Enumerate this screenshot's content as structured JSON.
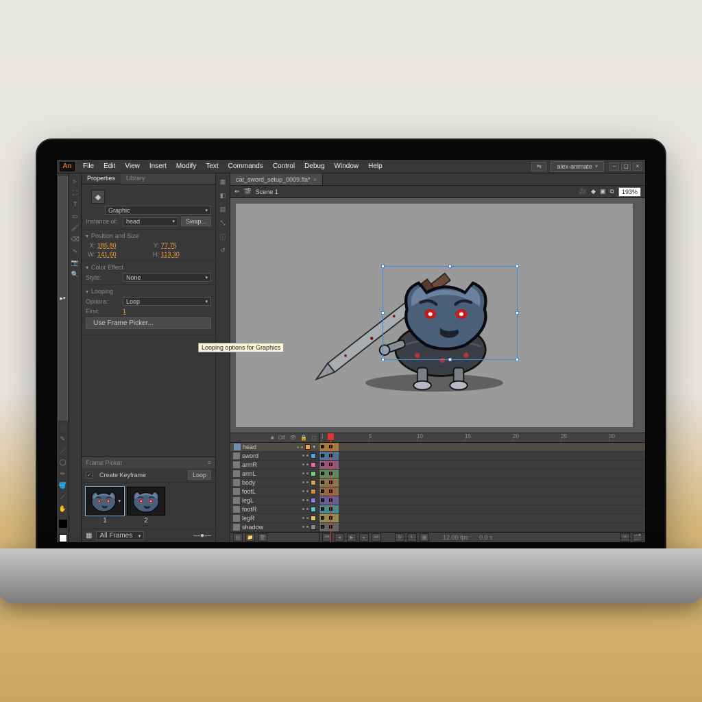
{
  "app": {
    "badge": "An"
  },
  "menubar": [
    "File",
    "Edit",
    "View",
    "Insert",
    "Modify",
    "Text",
    "Commands",
    "Control",
    "Debug",
    "Window",
    "Help"
  ],
  "workspace": "alex-animate",
  "document": {
    "tab": "cat_sword_setup_0009.fla*",
    "scene": "Scene 1",
    "zoom": "193%"
  },
  "panels": {
    "tabs": [
      "Properties",
      "Library"
    ],
    "instance": {
      "type": "Graphic",
      "label": "Instance of:",
      "name": "head",
      "swap": "Swap..."
    },
    "pos": {
      "title": "Position and Size",
      "x_label": "X:",
      "x": "185.80",
      "y_label": "Y:",
      "y": "77.75",
      "w_label": "W:",
      "w": "141.60",
      "h_label": "H:",
      "h": "113.30"
    },
    "colorfx": {
      "title": "Color Effect",
      "style_label": "Style:",
      "style": "None"
    },
    "looping": {
      "title": "Looping",
      "options_label": "Options:",
      "options": "Loop",
      "first_label": "First:",
      "first": "1",
      "button": "Use Frame Picker..."
    }
  },
  "framePicker": {
    "title": "Frame Picker",
    "createKeyframe": "Create Keyframe",
    "loop": "Loop",
    "frames": [
      "1",
      "2"
    ],
    "filter": "All Frames"
  },
  "tooltip": "Looping options for Graphics",
  "timeline": {
    "head_off": "Off",
    "layers": [
      {
        "name": "head",
        "sel": true,
        "color": "#f2a33a"
      },
      {
        "name": "sword",
        "sel": false,
        "color": "#5aa0e0"
      },
      {
        "name": "armR",
        "sel": false,
        "color": "#e06aa7"
      },
      {
        "name": "armL",
        "sel": false,
        "color": "#78c978"
      },
      {
        "name": "body",
        "sel": false,
        "color": "#c9a85a"
      },
      {
        "name": "footL",
        "sel": false,
        "color": "#e08a4a"
      },
      {
        "name": "legL",
        "sel": false,
        "color": "#8a7ae0"
      },
      {
        "name": "footR",
        "sel": false,
        "color": "#5ac9c9"
      },
      {
        "name": "legR",
        "sel": false,
        "color": "#e0c95a"
      },
      {
        "name": "shadow",
        "sel": false,
        "color": "#888"
      }
    ],
    "ruler": [
      "1",
      "5",
      "10",
      "15",
      "20",
      "25",
      "30"
    ],
    "fps_label": "12.00 fps",
    "time_label": "0.0 s"
  },
  "colors": {
    "accent": "#d47522"
  }
}
